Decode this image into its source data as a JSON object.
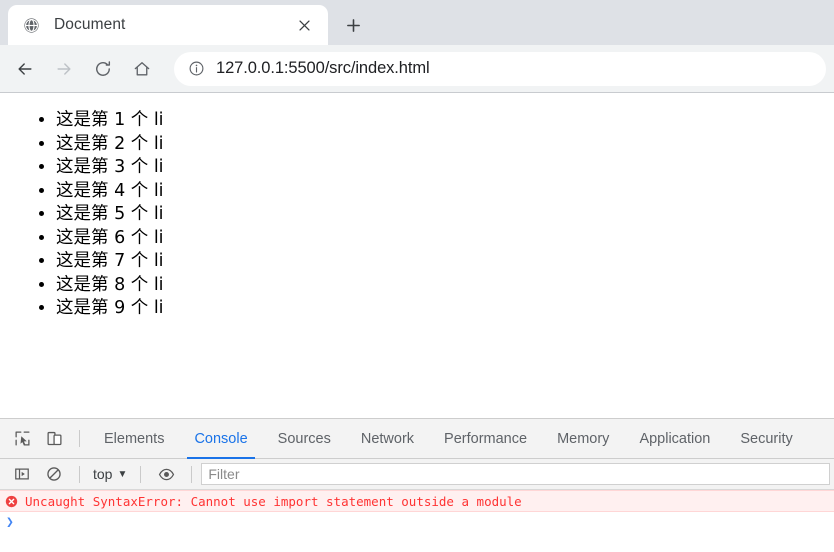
{
  "browser": {
    "tab": {
      "favicon": "globe-icon",
      "title": "Document",
      "close_label": "×"
    },
    "new_tab_label": "+",
    "nav": {
      "back": "←",
      "forward": "→",
      "reload": "↻",
      "home": "⌂"
    },
    "omnibox": {
      "security_icon": "info-circle-icon",
      "url": "127.0.0.1:5500/src/index.html"
    }
  },
  "page": {
    "list_items": [
      "这是第 1 个 li",
      "这是第 2 个 li",
      "这是第 3 个 li",
      "这是第 4 个 li",
      "这是第 5 个 li",
      "这是第 6 个 li",
      "这是第 7 个 li",
      "这是第 8 个 li",
      "这是第 9 个 li"
    ]
  },
  "devtools": {
    "inspect_icon": "inspect-element-icon",
    "device_icon": "device-toolbar-icon",
    "tabs": [
      {
        "label": "Elements",
        "active": false
      },
      {
        "label": "Console",
        "active": true
      },
      {
        "label": "Sources",
        "active": false
      },
      {
        "label": "Network",
        "active": false
      },
      {
        "label": "Performance",
        "active": false
      },
      {
        "label": "Memory",
        "active": false
      },
      {
        "label": "Application",
        "active": false
      },
      {
        "label": "Security",
        "active": false
      }
    ],
    "console_toolbar": {
      "sidebar_icon": "console-sidebar-icon",
      "clear_icon": "clear-console-icon",
      "context_value": "top",
      "context_caret": "▼",
      "eye_icon": "live-expression-eye-icon",
      "filter_placeholder": "Filter"
    },
    "console_messages": [
      {
        "level": "error",
        "icon": "error-circle-icon",
        "text": "Uncaught SyntaxError: Cannot use import statement outside a module"
      }
    ],
    "prompt_caret": "❯"
  },
  "colors": {
    "tabstrip_bg": "#dee1e6",
    "toolbar_bg": "#f1f3f4",
    "devtools_bg": "#f3f3f3",
    "accent_blue": "#1a73e8",
    "error_red": "#ff3333",
    "error_row_bg": "#fff0f0"
  }
}
